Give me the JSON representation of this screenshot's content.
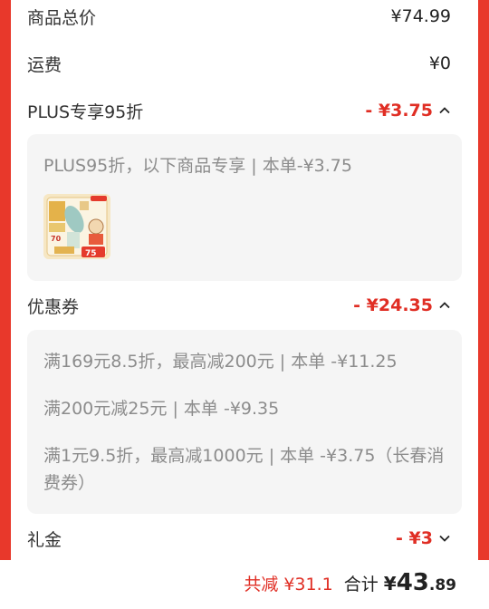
{
  "summary": {
    "goods_total": {
      "label": "商品总价",
      "value": "¥74.99"
    },
    "shipping": {
      "label": "运费",
      "value": "¥0"
    },
    "plus_discount": {
      "label": "PLUS专享95折",
      "value": "- ¥3.75"
    },
    "coupon": {
      "label": "优惠券",
      "value": "- ¥24.35"
    },
    "gift": {
      "label": "礼金",
      "value": "- ¥3"
    }
  },
  "plus_panel": {
    "text": "PLUS95折，以下商品专享 | 本单-¥3.75",
    "product_badge": "75"
  },
  "coupon_panel": {
    "items": [
      "满169元8.5折，最高减200元 | 本单 -¥11.25",
      "满200元减25元 | 本单 -¥9.35",
      "满1元9.5折，最高减1000元 | 本单 -¥3.75（长春消费券）"
    ]
  },
  "footer": {
    "saved_label": "共减",
    "saved_value": "¥31.1",
    "total_label": "合计",
    "total_currency": "¥",
    "total_int": "43",
    "total_dec": ".89"
  },
  "colors": {
    "accent": "#e02e24",
    "background": "#e8382b",
    "panel": "#f5f5f5"
  }
}
